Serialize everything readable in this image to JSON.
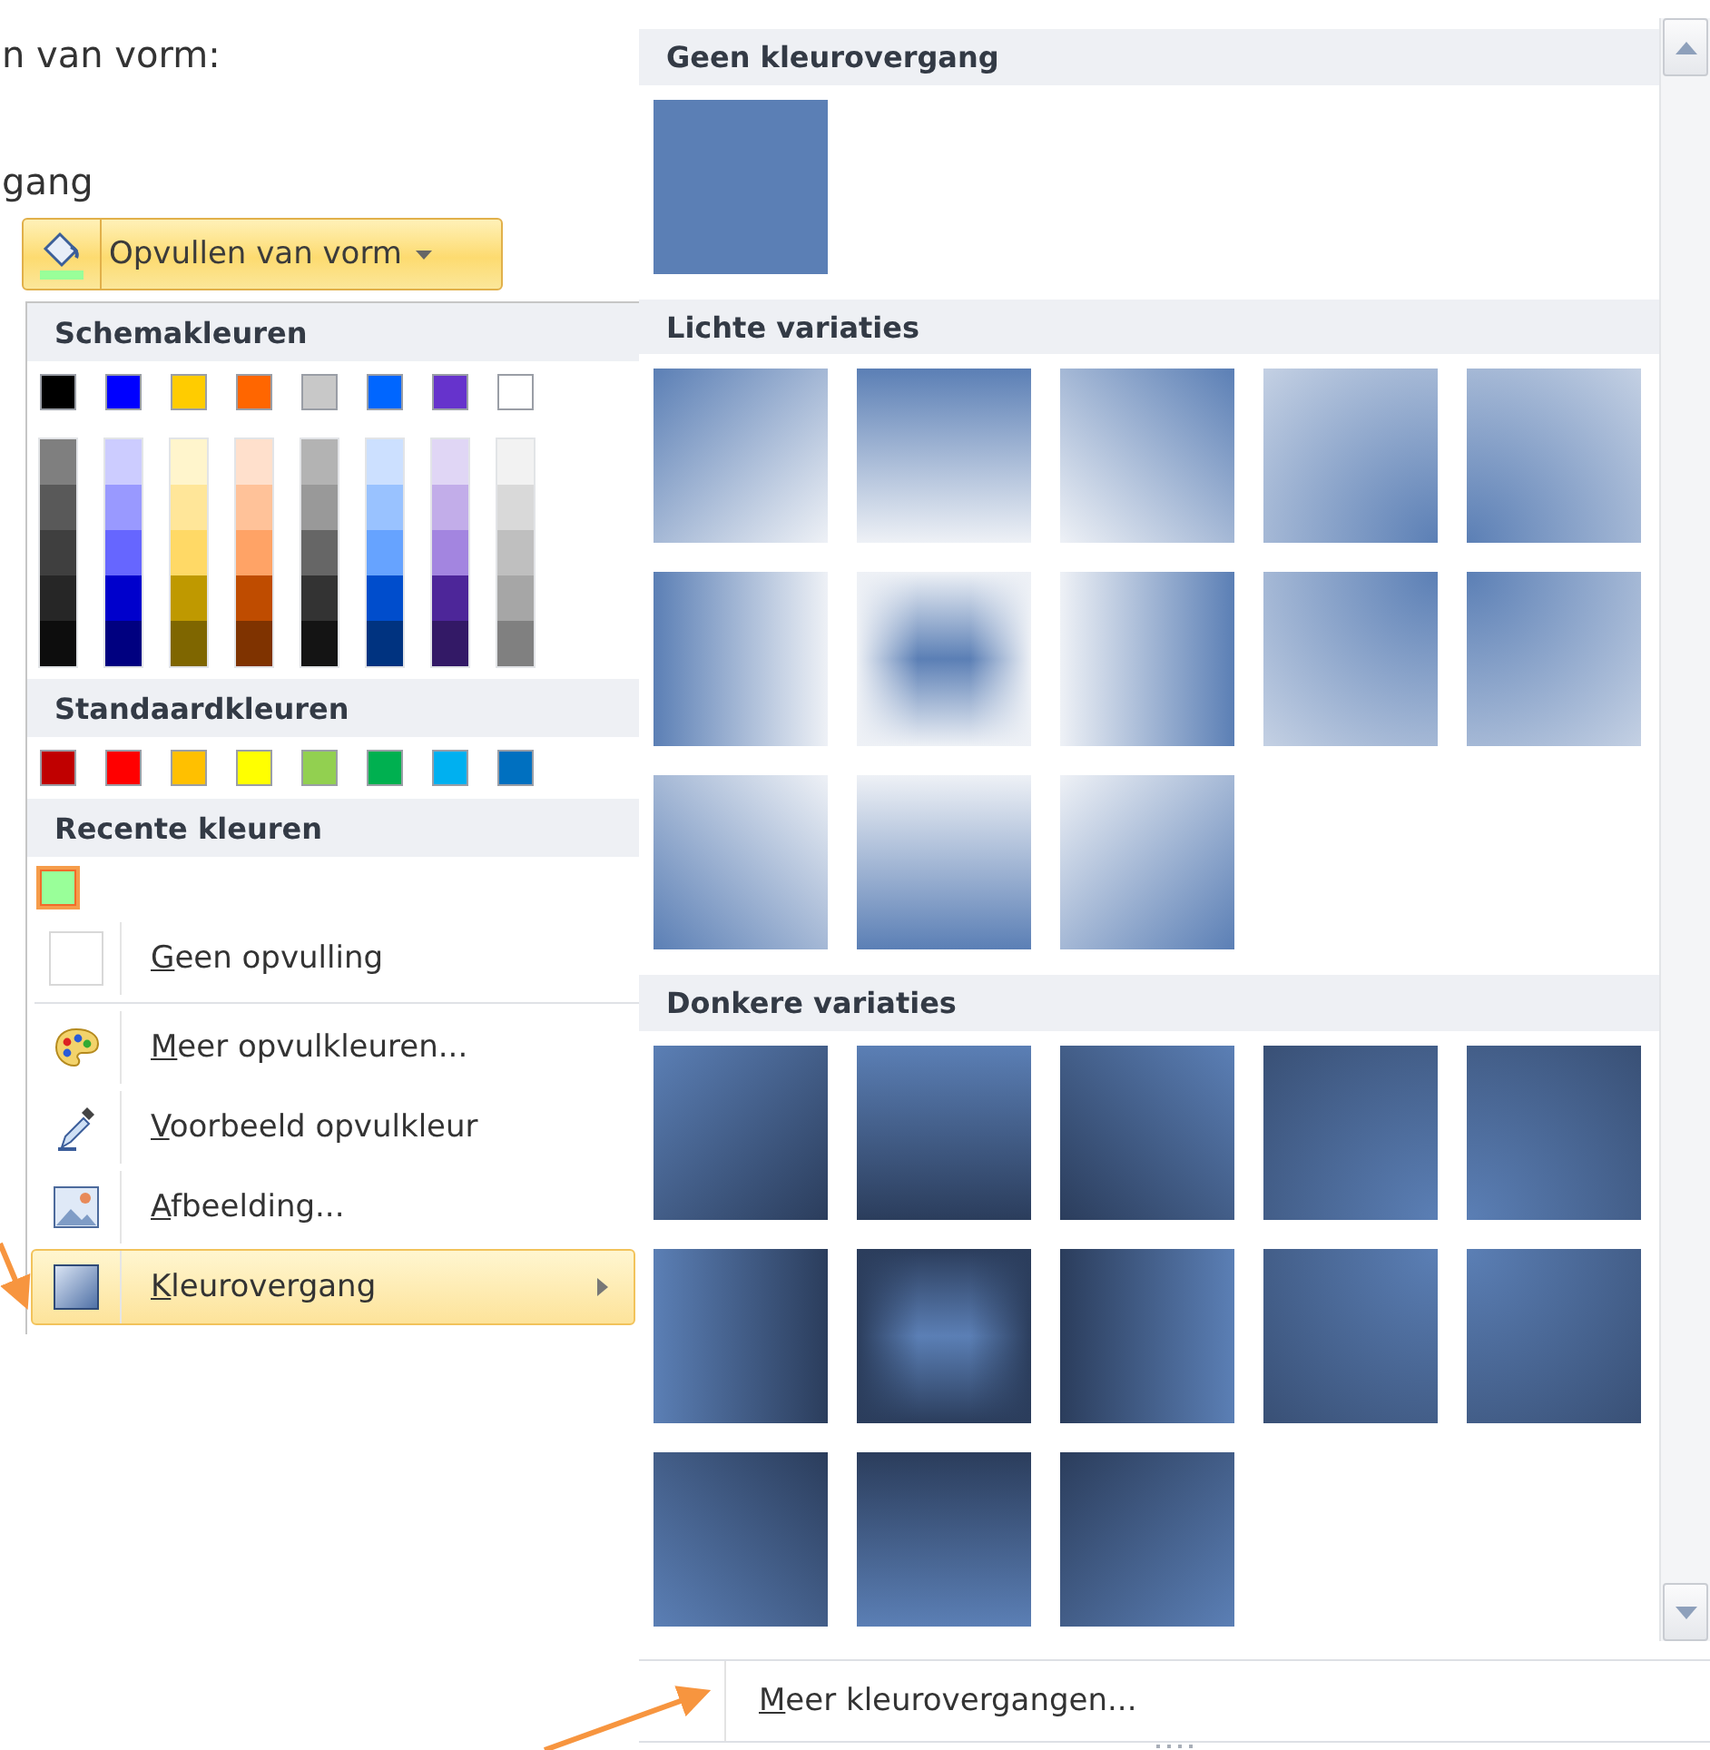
{
  "document": {
    "lines": [
      "n van vorm:",
      "gang"
    ]
  },
  "ribbon_button": {
    "label": "Opvullen van vorm"
  },
  "fill_menu": {
    "theme_colors": {
      "title": "Schemakleuren",
      "top": [
        {
          "color": "#000000"
        },
        {
          "color": "#0000ff"
        },
        {
          "color": "#ffcc00"
        },
        {
          "color": "#ff6600"
        },
        {
          "color": "#c8c8c8"
        },
        {
          "color": "#0066ff"
        },
        {
          "color": "#6633cc"
        },
        {
          "color": "#ffffff"
        }
      ],
      "shades": [
        {
          "colors": [
            {
              "color": "#7f7f7f"
            },
            {
              "color": "#595959"
            },
            {
              "color": "#3f3f3f"
            },
            {
              "color": "#262626"
            },
            {
              "color": "#0d0d0d"
            }
          ]
        },
        {
          "colors": [
            {
              "color": "#ccccff"
            },
            {
              "color": "#9999ff"
            },
            {
              "color": "#6666ff"
            },
            {
              "color": "#0000cc"
            },
            {
              "color": "#000080"
            }
          ]
        },
        {
          "colors": [
            {
              "color": "#fff5cc"
            },
            {
              "color": "#ffe699"
            },
            {
              "color": "#ffd966"
            },
            {
              "color": "#bf9900"
            },
            {
              "color": "#7f6600"
            }
          ]
        },
        {
          "colors": [
            {
              "color": "#ffe0cc"
            },
            {
              "color": "#ffc299"
            },
            {
              "color": "#ffa366"
            },
            {
              "color": "#bf4c00"
            },
            {
              "color": "#7f3300"
            }
          ]
        },
        {
          "colors": [
            {
              "color": "#b3b3b3"
            },
            {
              "color": "#999999"
            },
            {
              "color": "#666666"
            },
            {
              "color": "#333333"
            },
            {
              "color": "#141414"
            }
          ]
        },
        {
          "colors": [
            {
              "color": "#cce0ff"
            },
            {
              "color": "#99c2ff"
            },
            {
              "color": "#66a3ff"
            },
            {
              "color": "#004dcc"
            },
            {
              "color": "#003380"
            }
          ]
        },
        {
          "colors": [
            {
              "color": "#e0d6f5"
            },
            {
              "color": "#c2ade9"
            },
            {
              "color": "#a385e0"
            },
            {
              "color": "#4d2699"
            },
            {
              "color": "#331966"
            }
          ]
        },
        {
          "colors": [
            {
              "color": "#f2f2f2"
            },
            {
              "color": "#d9d9d9"
            },
            {
              "color": "#bfbfbf"
            },
            {
              "color": "#a6a6a6"
            },
            {
              "color": "#808080"
            }
          ]
        }
      ]
    },
    "standard_colors": {
      "title": "Standaardkleuren",
      "colors": [
        {
          "color": "#c00000"
        },
        {
          "color": "#ff0000"
        },
        {
          "color": "#ffc000"
        },
        {
          "color": "#ffff00"
        },
        {
          "color": "#92d050"
        },
        {
          "color": "#00b050"
        },
        {
          "color": "#00b0f0"
        },
        {
          "color": "#0070c0"
        }
      ]
    },
    "recent_colors": {
      "title": "Recente kleuren",
      "colors": [
        {
          "color": "#99ff99",
          "selected": true
        }
      ]
    },
    "items": [
      {
        "kind": "none",
        "label": "Geen opvulling",
        "selected": false,
        "submenu": false
      },
      {
        "kind": "palette",
        "label": "Meer opvulkleuren...",
        "selected": false,
        "submenu": false
      },
      {
        "kind": "eyedropper",
        "label": "Voorbeeld opvulkleur",
        "selected": false,
        "submenu": false
      },
      {
        "kind": "picture",
        "label": "Afbeelding...",
        "selected": false,
        "submenu": false
      },
      {
        "kind": "gradient",
        "label": "Kleurovergang",
        "selected": true,
        "submenu": true
      }
    ]
  },
  "gradient_gallery": {
    "sections": [
      {
        "title": "Geen kleurovergang",
        "kind": "none",
        "tiles": [
          {
            "kind": "solid"
          }
        ]
      },
      {
        "title": "Lichte variaties",
        "kind": "light",
        "tiles": [
          {
            "kind": "linear-tl"
          },
          {
            "kind": "linear-t"
          },
          {
            "kind": "linear-tr"
          },
          {
            "kind": "radial-br"
          },
          {
            "kind": "radial-bl"
          },
          {
            "kind": "linear-l"
          },
          {
            "kind": "rect-center"
          },
          {
            "kind": "linear-r"
          },
          {
            "kind": "radial-tr"
          },
          {
            "kind": "radial-tl"
          },
          {
            "kind": "linear-bl"
          },
          {
            "kind": "linear-b"
          },
          {
            "kind": "linear-br"
          }
        ]
      },
      {
        "title": "Donkere variaties",
        "kind": "dark",
        "tiles": [
          {
            "kind": "linear-tl"
          },
          {
            "kind": "linear-t"
          },
          {
            "kind": "linear-tr"
          },
          {
            "kind": "radial-br"
          },
          {
            "kind": "radial-bl"
          },
          {
            "kind": "linear-l"
          },
          {
            "kind": "rect-center"
          },
          {
            "kind": "linear-r"
          },
          {
            "kind": "radial-tr"
          },
          {
            "kind": "radial-tl"
          },
          {
            "kind": "linear-bl"
          },
          {
            "kind": "linear-b"
          },
          {
            "kind": "linear-br"
          }
        ]
      }
    ],
    "footer_link": "Meer kleurovergangen..."
  }
}
